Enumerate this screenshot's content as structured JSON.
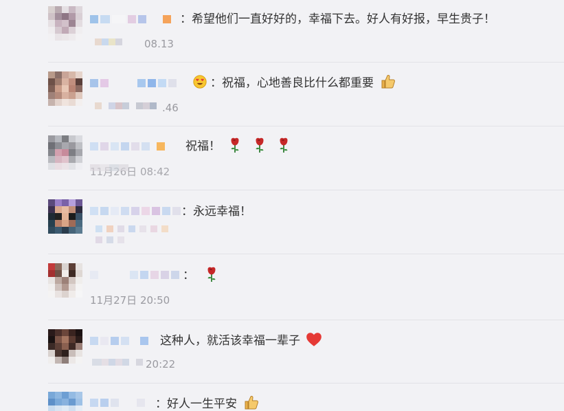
{
  "comments": [
    {
      "text": "：希望他们一直好好的，幸福下去。好人有好报，早生贵子！",
      "time": "08.13"
    },
    {
      "text": "：祝福，心地善良比什么都重要",
      "time": ".46"
    },
    {
      "text": "祝福！",
      "time": "11月26日 08:42"
    },
    {
      "text": "：永远幸福！",
      "time": ""
    },
    {
      "text": "：",
      "time": "11月27日 20:50"
    },
    {
      "text": "这种人，就活该幸福一辈子",
      "time": "20:22"
    },
    {
      "text": "：好人一生平安",
      "time": ""
    }
  ],
  "icons": {
    "thumbs_up": "thumbs-up-icon",
    "rose": "rose-icon",
    "heart": "heart-icon",
    "heart_eyes": "heart-eyes-icon"
  },
  "colors": {
    "background": "#f2f2f5",
    "separator": "#e2e2e6",
    "text": "#333333",
    "time": "#9a9aa0"
  }
}
